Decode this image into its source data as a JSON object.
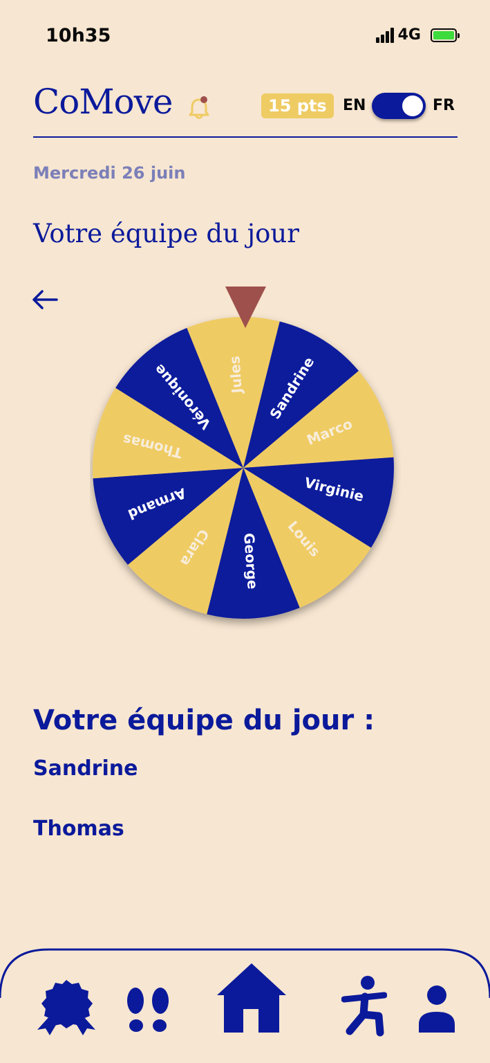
{
  "status_bar": {
    "time": "10h35",
    "network": "4G",
    "battery_color": "#3DDB3D"
  },
  "header": {
    "brand": "CoMove",
    "points": "15 pts",
    "lang_left": "EN",
    "lang_right": "FR",
    "toggle_selected": "FR"
  },
  "date": "Mercredi 26 juin",
  "page_title": "Votre équipe du jour",
  "wheel": {
    "pointer_color": "#9E504C",
    "colors": {
      "yellow": "#EFCB63",
      "blue": "#0B1A9B"
    },
    "segments": [
      {
        "name": "Jules",
        "color": "yellow"
      },
      {
        "name": "Sandrine",
        "color": "blue"
      },
      {
        "name": "Marco",
        "color": "yellow"
      },
      {
        "name": "Virginie",
        "color": "blue"
      },
      {
        "name": "Louis",
        "color": "yellow"
      },
      {
        "name": "George",
        "color": "blue"
      },
      {
        "name": "Clara",
        "color": "yellow"
      },
      {
        "name": "Armand",
        "color": "blue"
      },
      {
        "name": "Thomas",
        "color": "yellow"
      },
      {
        "name": "Véronique",
        "color": "blue"
      }
    ]
  },
  "team": {
    "title": "Votre équipe du jour :",
    "members": [
      "Sandrine",
      "Thomas"
    ]
  },
  "nav": {
    "items": [
      "badge-icon",
      "footprints-icon",
      "home-icon",
      "exercise-icon",
      "profile-icon"
    ],
    "active": "home-icon"
  }
}
